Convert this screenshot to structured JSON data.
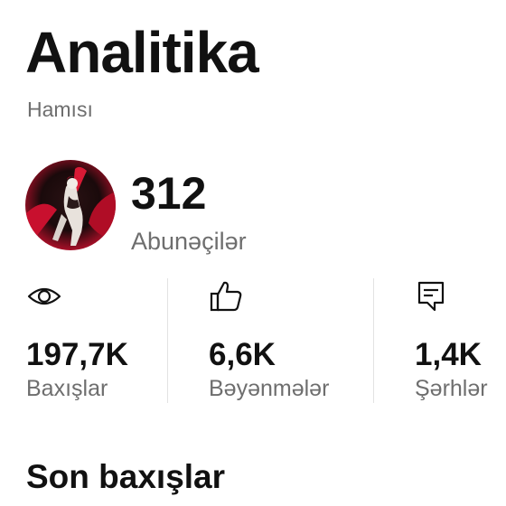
{
  "header": {
    "title": "Analitika",
    "filter": "Hamısı"
  },
  "profile": {
    "subscribers_count": "312",
    "subscribers_label": "Abunəçilər"
  },
  "stats": [
    {
      "icon": "eye-icon",
      "value": "197,7K",
      "label": "Baxışlar"
    },
    {
      "icon": "thumbs-up-icon",
      "value": "6,6K",
      "label": "Bəyənmələr"
    },
    {
      "icon": "comment-icon",
      "value": "1,4K",
      "label": "Şərhlər"
    }
  ],
  "recent": {
    "title": "Son baxışlar"
  },
  "colors": {
    "text_primary": "#111111",
    "text_secondary": "#6e6e6e",
    "divider": "#e2e2e2",
    "avatar_red": "#c8102e"
  }
}
